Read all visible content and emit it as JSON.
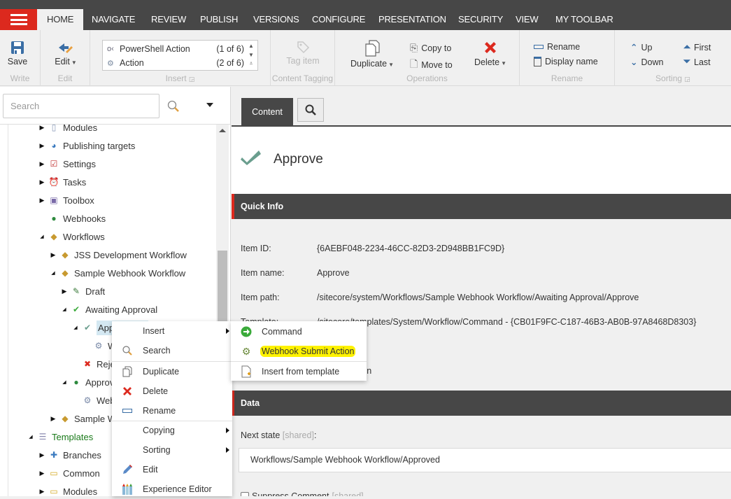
{
  "ribbon_tabs": [
    {
      "label": "HOME",
      "active": true
    },
    {
      "label": "NAVIGATE"
    },
    {
      "label": "REVIEW"
    },
    {
      "label": "PUBLISH"
    },
    {
      "label": "VERSIONS"
    },
    {
      "label": "CONFIGURE"
    },
    {
      "label": "PRESENTATION"
    },
    {
      "label": "SECURITY"
    },
    {
      "label": "VIEW"
    },
    {
      "label": "MY TOOLBAR"
    }
  ],
  "ribbon": {
    "write": {
      "group_label": "Write",
      "save_label": "Save"
    },
    "edit": {
      "group_label": "Edit",
      "edit_label": "Edit"
    },
    "insert": {
      "group_label": "Insert",
      "items": [
        {
          "label": "PowerShell Action",
          "count": "(1 of 6)",
          "icon": "powershell-icon"
        },
        {
          "label": "Action",
          "count": "(2 of 6)",
          "icon": "action-gear-icon"
        }
      ]
    },
    "tagging": {
      "group_label": "Content Tagging",
      "tag_label": "Tag item"
    },
    "operations": {
      "group_label": "Operations",
      "duplicate_label": "Duplicate",
      "copy_to_label": "Copy to",
      "move_to_label": "Move to",
      "delete_label": "Delete"
    },
    "rename": {
      "group_label": "Rename",
      "rename_label": "Rename",
      "display_name_label": "Display name"
    },
    "sorting": {
      "group_label": "Sorting",
      "up": "Up",
      "down": "Down",
      "first": "First",
      "last": "Last"
    }
  },
  "search": {
    "placeholder": "Search"
  },
  "tree": [
    {
      "label": "Modules",
      "toggle": "collapsed",
      "icon": "modules-icon",
      "level": 2
    },
    {
      "label": "Publishing targets",
      "toggle": "collapsed",
      "icon": "publishing-targets-icon",
      "level": 2
    },
    {
      "label": "Settings",
      "toggle": "collapsed",
      "icon": "settings-icon",
      "level": 2
    },
    {
      "label": "Tasks",
      "toggle": "collapsed",
      "icon": "tasks-clock-icon",
      "level": 2
    },
    {
      "label": "Toolbox",
      "toggle": "collapsed",
      "icon": "toolbox-icon",
      "level": 2
    },
    {
      "label": "Webhooks",
      "toggle": "none",
      "icon": "globe-icon",
      "level": 2
    },
    {
      "label": "Workflows",
      "toggle": "expanded",
      "icon": "workflow-icon",
      "level": 2
    },
    {
      "label": "JSS Development Workflow",
      "toggle": "collapsed",
      "icon": "workflow-icon",
      "level": 3
    },
    {
      "label": "Sample Webhook Workflow",
      "toggle": "expanded",
      "icon": "workflow-icon",
      "level": 3
    },
    {
      "label": "Draft",
      "toggle": "collapsed",
      "icon": "draft-icon",
      "level": 4
    },
    {
      "label": "Awaiting Approval",
      "toggle": "expanded",
      "icon": "awaiting-approval-icon",
      "level": 4
    },
    {
      "label": "Approve",
      "toggle": "expanded",
      "icon": "checkmark-icon",
      "level": 5,
      "selected": true
    },
    {
      "label": "Webhook",
      "toggle": "none",
      "icon": "webhook-action-icon",
      "level": 6
    },
    {
      "label": "Reject",
      "toggle": "none",
      "icon": "reject-icon",
      "level": 5
    },
    {
      "label": "Approved",
      "toggle": "expanded",
      "icon": "globe-icon",
      "level": 4
    },
    {
      "label": "Webhook",
      "toggle": "none",
      "icon": "webhook-action-icon",
      "level": 5
    },
    {
      "label": "Sample Workflow",
      "toggle": "collapsed",
      "icon": "workflow-icon",
      "level": 3
    },
    {
      "label": "Templates",
      "toggle": "expanded",
      "icon": "templates-icon",
      "level": 1
    },
    {
      "label": "Branches",
      "toggle": "collapsed",
      "icon": "branches-icon",
      "level": 2
    },
    {
      "label": "Common",
      "toggle": "collapsed",
      "icon": "folder-icon",
      "level": 2
    },
    {
      "label": "Modules",
      "toggle": "collapsed",
      "icon": "folder-icon",
      "level": 2
    }
  ],
  "content": {
    "tab_label": "Content",
    "item_title": "Approve",
    "quick_info": {
      "title": "Quick Info",
      "rows": [
        {
          "label": "Item ID:",
          "value": "{6AEBF048-2234-46CC-82D3-2D948BB1FC9D}"
        },
        {
          "label": "Item name:",
          "value": "Approve"
        },
        {
          "label": "Item path:",
          "value": "/sitecore/system/Workflows/Sample Webhook Workflow/Awaiting Approval/Approve"
        },
        {
          "label": "Template:",
          "value": "/sitecore/templates/System/Workflow/Command - {CB01F9FC-C187-46B3-AB0B-97A8468D8303}"
        },
        {
          "label": "",
          "value": ""
        },
        {
          "label": "",
          "value": "min"
        }
      ]
    },
    "data_section": {
      "title": "Data",
      "next_state_label": "Next state",
      "shared_tag": "[shared]",
      "next_state_value": "Workflows/Sample Webhook Workflow/Approved",
      "suppress_comment_label": "Suppress Comment",
      "suppress_comment_checked": false
    }
  },
  "context_menu": {
    "items": [
      {
        "label": "Insert",
        "icon": "",
        "submenu": true
      },
      {
        "label": "Search",
        "icon": "search-icon"
      },
      {
        "label": "Duplicate",
        "icon": "duplicate-icon"
      },
      {
        "label": "Delete",
        "icon": "delete-icon"
      },
      {
        "label": "Rename",
        "icon": "rename-icon"
      },
      {
        "label": "Copying",
        "icon": "",
        "submenu": true
      },
      {
        "label": "Sorting",
        "icon": "",
        "submenu": true
      },
      {
        "label": "Edit",
        "icon": "pencil-icon"
      },
      {
        "label": "Experience Editor",
        "icon": "experience-editor-icon"
      }
    ]
  },
  "insert_submenu": {
    "items": [
      {
        "label": "Command",
        "icon": "command-arrow-icon"
      },
      {
        "label": "Webhook Submit Action",
        "icon": "webhook-action-icon",
        "highlighted": true
      },
      {
        "label": "Insert from template",
        "icon": "insert-from-template-icon"
      }
    ]
  },
  "colors": {
    "brand_red": "#dc291e",
    "dark_bar": "#474747",
    "highlight_yellow": "#fef200",
    "selected_row": "#d4e8f2",
    "templates_green": "#1a7a1a",
    "icon_blue": "#3a6ea5"
  }
}
